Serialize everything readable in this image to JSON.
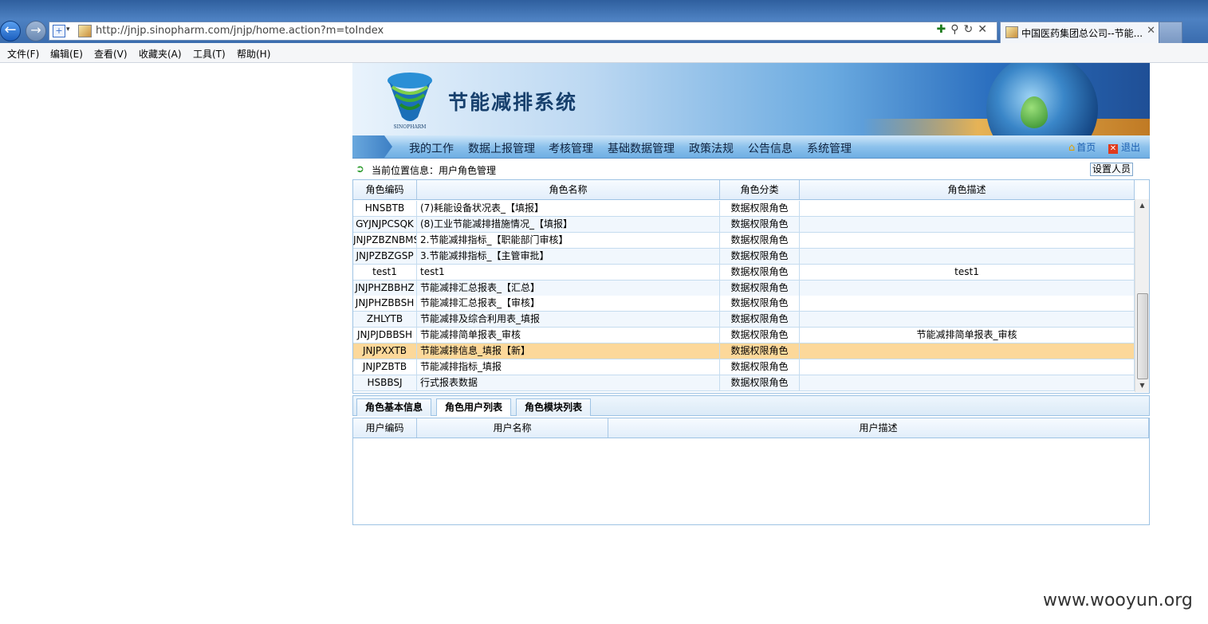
{
  "browser": {
    "url": "http://jnjp.sinopharm.com/jnjp/home.action?m=toIndex",
    "tab_title": "中国医药集团总公司--节能...",
    "menu": [
      "文件(F)",
      "编辑(E)",
      "查看(V)",
      "收藏夹(A)",
      "工具(T)",
      "帮助(H)"
    ]
  },
  "app": {
    "title": "节能减排系统",
    "logo_text": "SINOPHARM",
    "nav": [
      "我的工作",
      "数据上报管理",
      "考核管理",
      "基础数据管理",
      "政策法规",
      "公告信息",
      "系统管理"
    ],
    "home_label": "首页",
    "exit_label": "退出"
  },
  "location": {
    "text": "当前位置信息：用户角色管理",
    "set_button": "设置人员"
  },
  "roles": {
    "columns": [
      "角色编码",
      "角色名称",
      "角色分类",
      "角色描述"
    ],
    "rows": [
      {
        "code": "HNSBTB",
        "name": "(7)耗能设备状况表_【填报】",
        "category": "数据权限角色",
        "desc": ""
      },
      {
        "code": "GYJNJPCSQK",
        "name": "(8)工业节能减排措施情况_【填报】",
        "category": "数据权限角色",
        "desc": ""
      },
      {
        "code": "JNJPZBZNBMS",
        "name": "2.节能减排指标_【职能部门审核】",
        "category": "数据权限角色",
        "desc": ""
      },
      {
        "code": "JNJPZBZGSP",
        "name": "3.节能减排指标_【主管审批】",
        "category": "数据权限角色",
        "desc": ""
      },
      {
        "code": "test1",
        "name": "test1",
        "category": "数据权限角色",
        "desc": "test1"
      },
      {
        "code": "JNJPHZBBHZ",
        "name": "节能减排汇总报表_【汇总】",
        "category": "数据权限角色",
        "desc": ""
      },
      {
        "code": "JNJPHZBBSH",
        "name": "节能减排汇总报表_【审核】",
        "category": "数据权限角色",
        "desc": ""
      },
      {
        "code": "ZHLYTB",
        "name": "节能减排及综合利用表_填报",
        "category": "数据权限角色",
        "desc": ""
      },
      {
        "code": "JNJPJDBBSH",
        "name": "节能减排简单报表_审核",
        "category": "数据权限角色",
        "desc": "节能减排简单报表_审核"
      },
      {
        "code": "JNJPXXTB",
        "name": "节能减排信息_填报【新】",
        "category": "数据权限角色",
        "desc": "",
        "selected": true
      },
      {
        "code": "JNJPZBTB",
        "name": "节能减排指标_填报",
        "category": "数据权限角色",
        "desc": ""
      },
      {
        "code": "HSBBSJ",
        "name": "行式报表数据",
        "category": "数据权限角色",
        "desc": ""
      }
    ]
  },
  "detail_tabs": [
    "角色基本信息",
    "角色用户列表",
    "角色模块列表"
  ],
  "users": {
    "columns": [
      "用户编码",
      "用户名称",
      "用户描述"
    ]
  },
  "watermark": "www.wooyun.org",
  "colors": {
    "selected_row": "#fcd89a",
    "nav_text": "#0f2340",
    "link": "#1b5fb0"
  }
}
